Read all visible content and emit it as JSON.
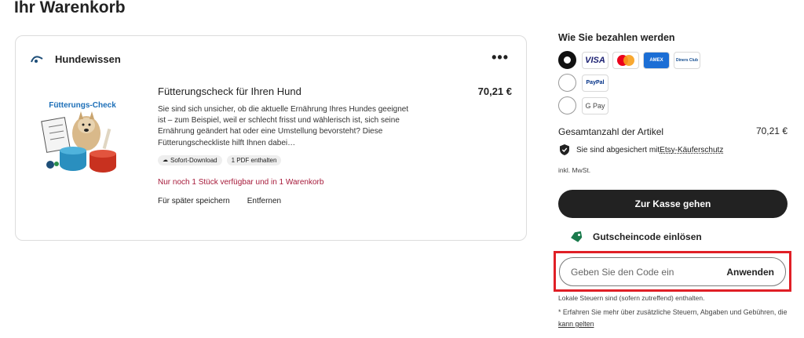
{
  "page": {
    "title": "Ihr Warenkorb"
  },
  "cart": {
    "shop_name": "Hundewissen",
    "more_label": "•••",
    "item": {
      "title": "Fütterungscheck für Ihren Hund",
      "description": "Sie sind sich unsicher, ob die aktuelle Ernährung Ihres Hundes geeignet ist – zum Beispiel, weil er schlecht frisst und wählerisch ist, sich seine Ernährung geändert hat oder eine Umstellung bevorsteht? Diese Fütterungscheckliste hilft Ihnen dabei…",
      "image_title": "Fütterungs-Check",
      "chips": [
        "Sofort-Download",
        "1 PDF enthalten"
      ],
      "stock_note": "Nur noch 1 Stück verfügbar und in 1 Warenkorb",
      "actions": [
        "Für später speichern",
        "Entfernen"
      ],
      "price": "70,21 €"
    }
  },
  "payment": {
    "heading": "Wie Sie bezahlen werden",
    "methods": [
      {
        "selected": true,
        "logos": [
          "VISA",
          "mastercard",
          "AMEX",
          "Diners Club"
        ]
      },
      {
        "selected": false,
        "logos": [
          "PayPal"
        ]
      },
      {
        "selected": false,
        "logos": [
          "G Pay"
        ]
      }
    ]
  },
  "summary": {
    "total_label": "Gesamtanzahl der Artikel",
    "total_value": "70,21 €",
    "protection_text": "Sie sind abgesichert mit",
    "protection_link": "Etsy-Käuferschutz",
    "tax_note": "inkl. MwSt.",
    "checkout_label": "Zur Kasse gehen"
  },
  "coupon": {
    "toggle_label": "Gutscheincode einlösen",
    "placeholder": "Geben Sie den Code ein",
    "apply_label": "Anwenden"
  },
  "footer": {
    "local_tax": "Lokale Steuern sind (sofern zutreffend) enthalten.",
    "footnote_text": "* Erfahren Sie mehr über zusätzliche Steuern, Abgaben und Gebühren, die ",
    "footnote_link": "kann gelten"
  },
  "colors": {
    "accent_dark": "#222222",
    "stock_red": "#a61a3a",
    "highlight": "#e01f26",
    "tag_green": "#1a7a4c"
  }
}
